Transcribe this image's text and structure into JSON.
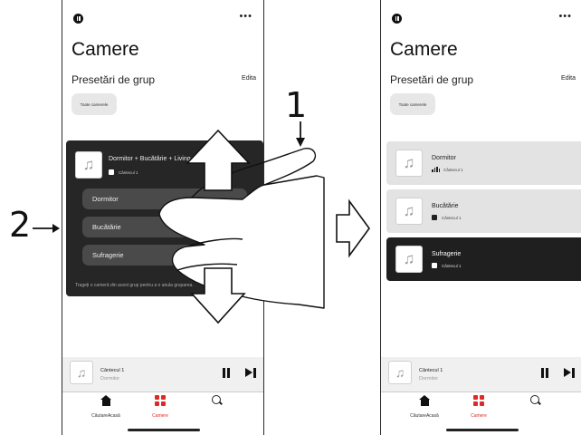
{
  "screens": {
    "left": {
      "title": "Camere",
      "section_title": "Presetări de grup",
      "edit_label": "Edita",
      "chip_label": "Toate camerele",
      "group": {
        "name": "Dormitor + Bucătărie + Living",
        "track": "Cântecul 1",
        "rooms": [
          "Dormitor",
          "Bucătărie",
          "Sufragerie"
        ],
        "hint": "Trageți o cameră din acest grup pentru a o anula gruparea."
      },
      "player": {
        "title": "Cântecul 1",
        "subtitle": "Dormitor"
      },
      "tabs": [
        "CăutareAcasă",
        "Camere",
        ""
      ]
    },
    "right": {
      "title": "Camere",
      "section_title": "Presetări de grup",
      "edit_label": "Edita",
      "chip_label": "Toate camerele",
      "rooms": [
        {
          "name": "Dormitor",
          "track": "Cântecul 1",
          "indicator": "playing-bars",
          "selected": false
        },
        {
          "name": "Bucătărie",
          "track": "Cântecul 1",
          "indicator": "square",
          "selected": false
        },
        {
          "name": "Sufragerie",
          "track": "Cântecul 1",
          "indicator": "square",
          "selected": true
        }
      ],
      "player": {
        "title": "Cântecul 1",
        "subtitle": "Dormitor"
      },
      "tabs": [
        "CăutareAcasă",
        "Camere",
        ""
      ]
    }
  },
  "annotations": {
    "callout_1": "1",
    "callout_2": "2"
  },
  "icons": {
    "status": "pause-circle-icon",
    "more": "more-dots-icon",
    "album": "music-note-icon",
    "home": "home-icon",
    "rooms": "rooms-grid-icon",
    "search": "search-icon"
  },
  "colors": {
    "accent": "#e02828",
    "dark_panel": "#262626",
    "room_card": "#e3e3e3"
  }
}
